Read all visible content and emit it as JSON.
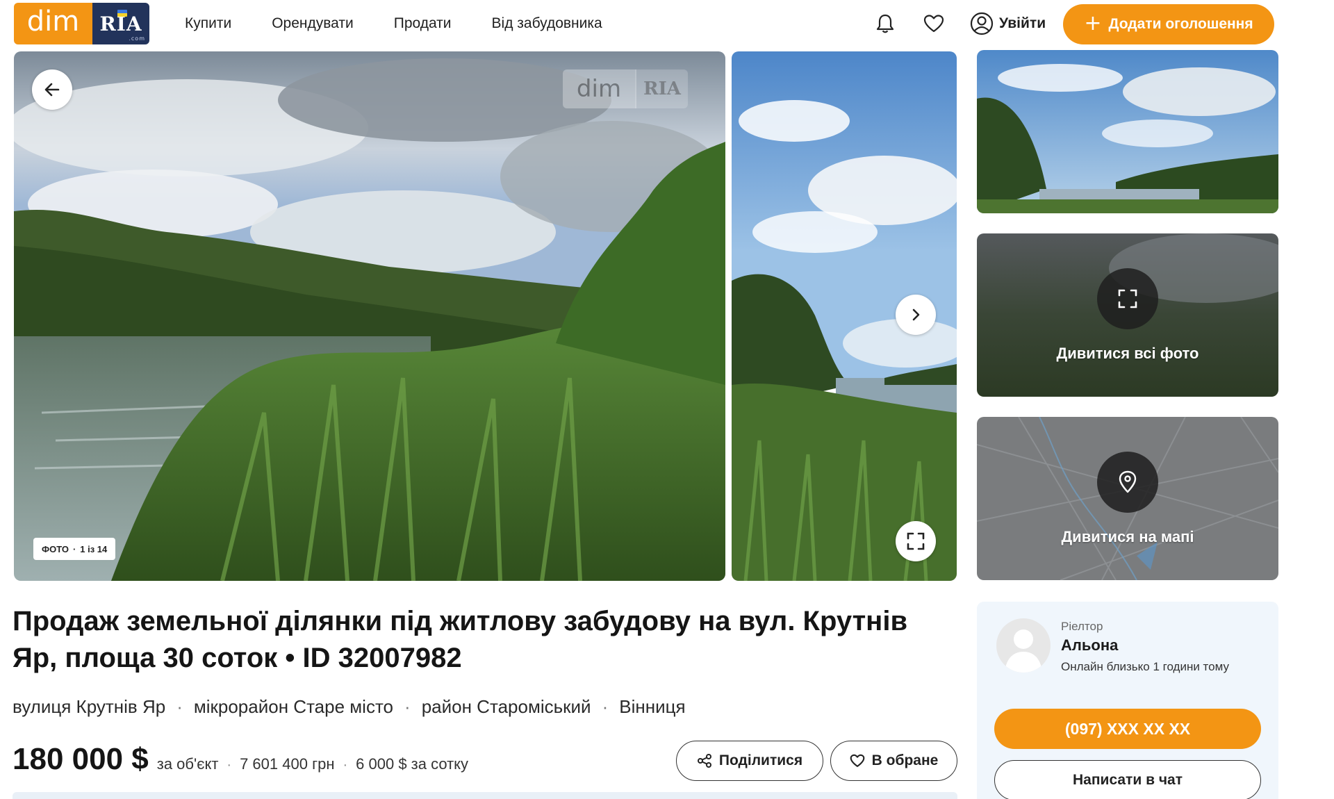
{
  "header": {
    "logo_dim": "dim",
    "logo_ria": "RIA",
    "nav": [
      "Купити",
      "Орендувати",
      "Продати",
      "Від забудовника"
    ],
    "login_label": "Увійти",
    "add_listing_label": "Додати оголошення",
    "icons": [
      "bell-icon",
      "heart-icon",
      "user-circle-icon",
      "plus-icon"
    ]
  },
  "gallery": {
    "watermark_dim": "dim",
    "watermark_ria": "RIA",
    "counter_label": "ФОТО",
    "counter_value": "1 із 14",
    "all_photos_label": "Дивитися всі фото",
    "map_label": "Дивитися на мапі"
  },
  "listing": {
    "title": "Продаж земельної ділянки під житлову забудову на вул. Крутнів Яр, площа 30 соток • ID 32007982",
    "address": [
      "вулиця Крутнів Яр",
      "мікрорайон Старе місто",
      "район Староміський",
      "Вінниця"
    ],
    "price": "180 000 $",
    "price_unit": "за об'єкт",
    "price_uah": "7 601 400 грн",
    "price_per_unit": "6 000 $ за сотку",
    "share_label": "Поділитися",
    "favorite_label": "В обране"
  },
  "agent": {
    "role": "Ріелтор",
    "name": "Альона",
    "status": "Онлайн близько 1 години тому",
    "phone": "(097) XXX XX XX",
    "chat_label": "Написати в чат"
  },
  "colors": {
    "brand_orange": "#f39514",
    "brand_navy": "#22335b",
    "agent_card_bg": "#f0f6fc"
  }
}
